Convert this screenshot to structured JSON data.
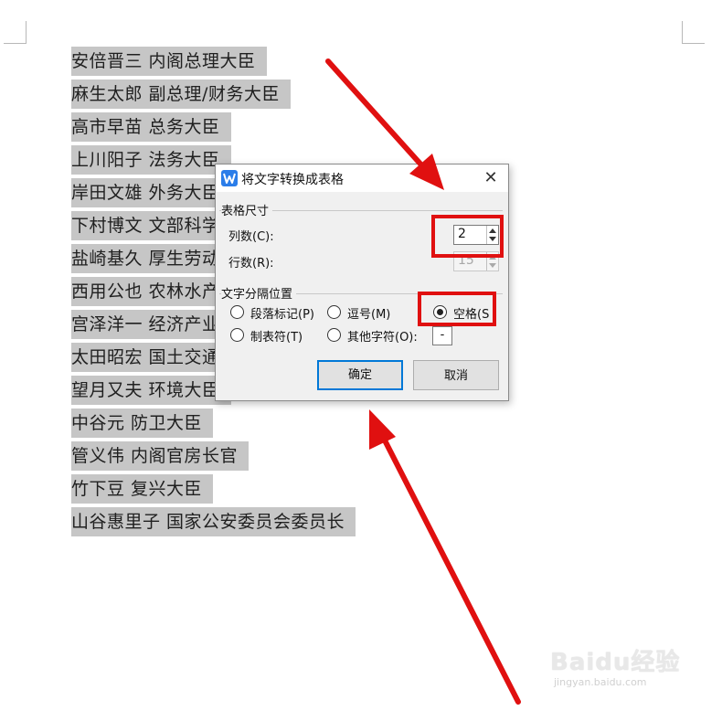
{
  "document": {
    "lines": [
      "安倍晋三  内阁总理大臣",
      "麻生太郎  副总理/财务大臣",
      "高市早苗  总务大臣",
      "上川阳子  法务大臣",
      "岸田文雄  外务大臣",
      "下村博文  文部科学大臣",
      "盐崎基久  厚生劳动大臣",
      "西用公也  农林水产大臣",
      "宫泽洋一  经济产业大臣",
      "太田昭宏  国土交通大臣",
      "望月又夫  环境大臣",
      "中谷元  防卫大臣",
      "管义伟  内阁官房长官",
      "竹下豆  复兴大臣",
      "山谷惠里子  国家公安委员会委员长"
    ]
  },
  "dialog": {
    "title": "将文字转换成表格",
    "close_symbol": "✕",
    "table_size_group": "表格尺寸",
    "columns_label": "列数(C):",
    "columns_value": "2",
    "rows_label": "行数(R):",
    "rows_value": "15",
    "separator_group": "文字分隔位置",
    "options": {
      "paragraph": "段落标记(P)",
      "comma": "逗号(M)",
      "space": "空格(S",
      "tab": "制表符(T)",
      "other": "其他字符(O):"
    },
    "selected_option": "space",
    "other_char_value": "-",
    "ok_label": "确定",
    "cancel_label": "取消"
  },
  "watermark": {
    "brand": "Baidu经验",
    "url": "jingyan.baidu.com"
  },
  "colors": {
    "highlight": "#e01010",
    "selection_bg": "#c6c6c6",
    "accent": "#0078d7",
    "app_icon": "#2b7de9"
  },
  "icons": [
    "wps-app-icon",
    "close-icon",
    "spin-up-icon",
    "spin-down-icon",
    "arrow-annotation"
  ]
}
